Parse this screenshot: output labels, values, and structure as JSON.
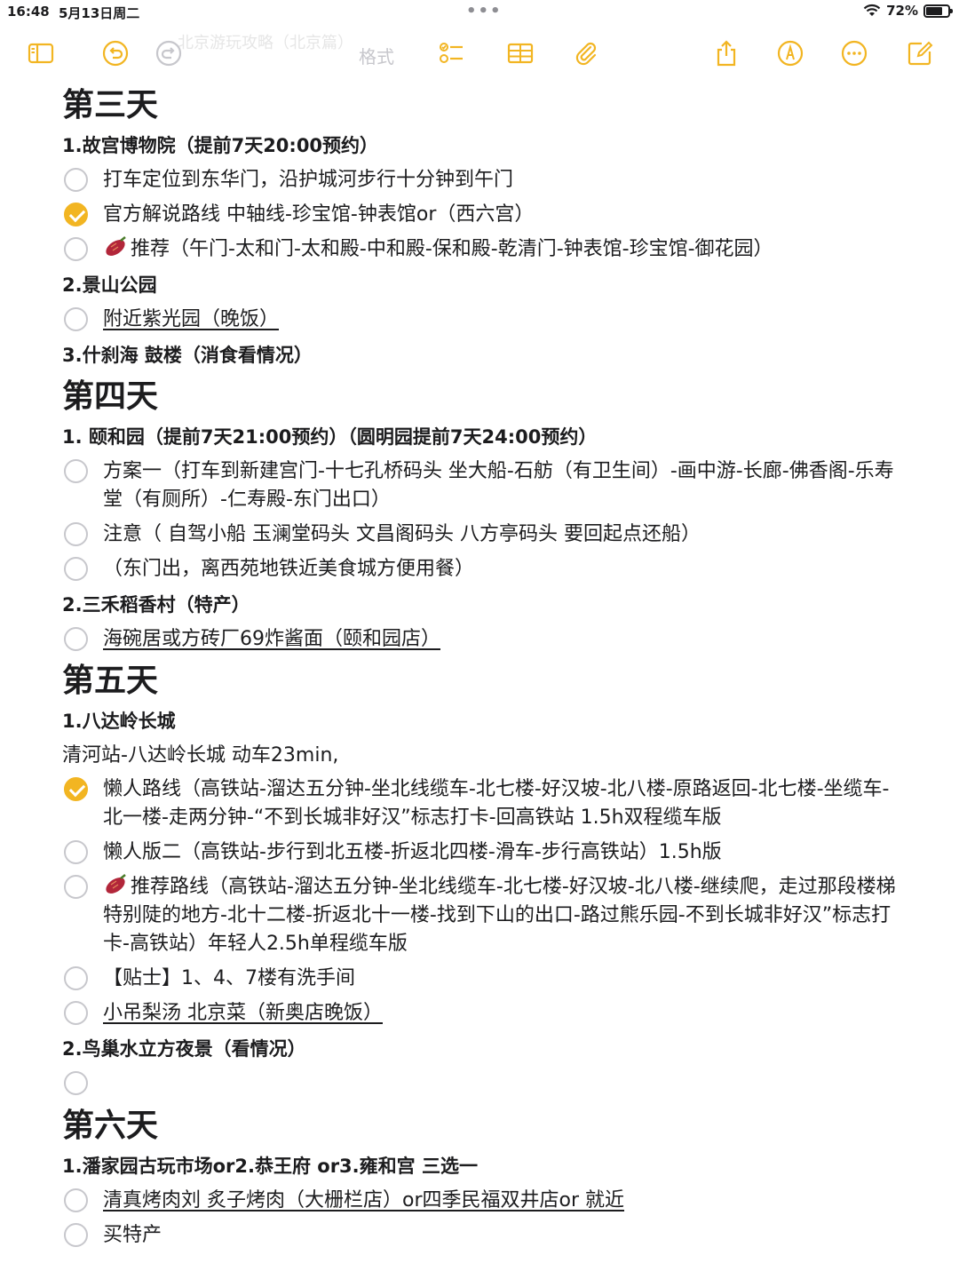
{
  "status": {
    "time": "16:48",
    "date": "5月13日周二",
    "battery": "72%",
    "battery_level": 0.72
  },
  "toolbar": {
    "format_label": "格式",
    "ghost_title": "北京游玩攻略（北京篇）"
  },
  "colors": {
    "accent": "#f2b522",
    "checkbox_empty": "#c7c7cc",
    "text": "#1c1c1e"
  },
  "icons": [
    "sidebar-icon",
    "undo-icon",
    "redo-icon",
    "checklist-icon",
    "table-icon",
    "attachment-icon",
    "share-icon",
    "markup-icon",
    "more-icon",
    "compose-icon",
    "sweet-potato-emoji"
  ],
  "day3": {
    "title": "第三天",
    "s1": "1.故宫博物院（提前7天20:00预约）",
    "i1": "打车定位到东华门，沿护城河步行十分钟到午门",
    "i2": "官方解说路线 中轴线-珍宝馆-钟表馆or（西六宫）",
    "i3": "推荐（午门-太和门-太和殿-中和殿-保和殿-乾清门-钟表馆-珍宝馆-御花园）",
    "s2": "2.景山公园",
    "i4": "附近紫光园（晚饭）",
    "s3": "3.什刹海 鼓楼（消食看情况）"
  },
  "day4": {
    "title": "第四天",
    "s1": "1. 颐和园（提前7天21:00预约）（圆明园提前7天24:00预约）",
    "i1": "方案一（打车到新建宫门-十七孔桥码头 坐大船-石舫（有卫生间）-画中游-长廊-佛香阁-乐寿堂（有厕所）-仁寿殿-东门出口）",
    "i2": "注意（ 自驾小船 玉澜堂码头 文昌阁码头 八方亭码头 要回起点还船）",
    "i3": "（东门出，离西苑地铁近美食城方便用餐）",
    "s2": "2.三禾稻香村（特产）",
    "i4": "海碗居或方砖厂69炸酱面（颐和园店）"
  },
  "day5": {
    "title": "第五天",
    "s1": "1.八达岭长城",
    "p1": "清河站-八达岭长城  动车23min,",
    "i1": "懒人路线（高铁站-溜达五分钟-坐北线缆车-北七楼-好汉坡-北八楼-原路返回-北七楼-坐缆车-北一楼-走两分钟-“不到长城非好汉”标志打卡-回高铁站 1.5h双程缆车版",
    "i2": "懒人版二（高铁站-步行到北五楼-折返北四楼-滑车-步行高铁站）1.5h版",
    "i3": "推荐路线（高铁站-溜达五分钟-坐北线缆车-北七楼-好汉坡-北八楼-继续爬，走过那段楼梯特别陡的地方-北十二楼-折返北十一楼-找到下山的出口-路过熊乐园-不到长城非好汉”标志打卡-高铁站）年轻人2.5h单程缆车版",
    "i4": "【贴士】1、4、7楼有洗手间",
    "i5": "小吊梨汤 北京菜（新奥店晚饭）",
    "s2": "2.鸟巢水立方夜景（看情况）",
    "i6": ""
  },
  "day6": {
    "title": "第六天",
    "s1": "1.潘家园古玩市场or2.恭王府 or3.雍和宫  三选一",
    "i1": "清真烤肉刘 炙子烤肉（大栅栏店）or四季民福双井店or  就近",
    "i2": "买特产"
  }
}
